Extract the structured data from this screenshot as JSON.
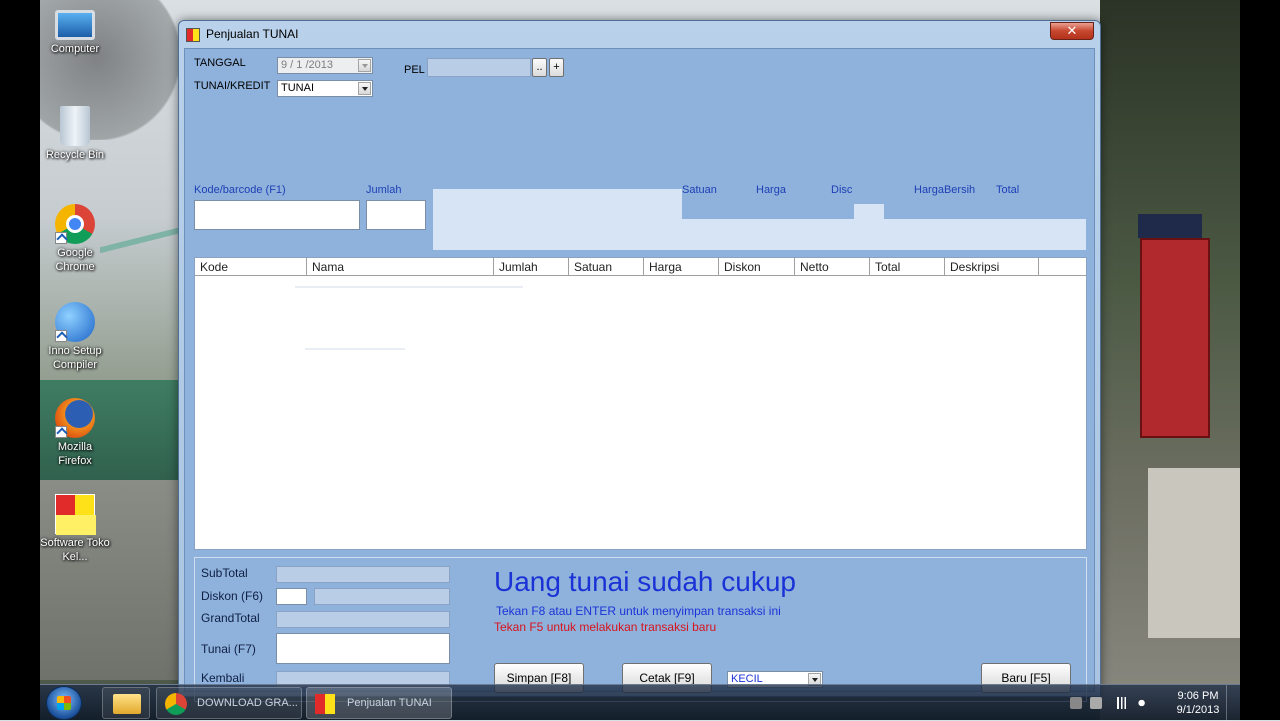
{
  "desktop": {
    "icons": [
      {
        "label": "Computer",
        "icon": "computer-icon"
      },
      {
        "label": "Recycle Bin",
        "icon": "recycle-bin-icon"
      },
      {
        "label": "Google Chrome",
        "icon": "chrome-icon"
      },
      {
        "label": "Inno Setup Compiler",
        "icon": "inno-setup-icon"
      },
      {
        "label": "Mozilla Firefox",
        "icon": "firefox-icon"
      },
      {
        "label": "Software Toko Kel...",
        "icon": "software-toko-icon"
      }
    ]
  },
  "window": {
    "title": "Penjualan TUNAI",
    "close_symbol": "✕"
  },
  "form": {
    "tanggal_label": "TANGGAL",
    "tanggal_value": "9 / 1 /2013",
    "tunai_kredit_label": "TUNAI/KREDIT",
    "tunai_kredit_value": "TUNAI",
    "pel_label": "PEL",
    "pel_browse_label": "..",
    "pel_add_label": "+"
  },
  "entry_headers": {
    "kode": "Kode/barcode (F1)",
    "jumlah": "Jumlah",
    "satuan": "Satuan",
    "harga": "Harga",
    "disc": "Disc",
    "harga_bersih": "HargaBersih",
    "total": "Total"
  },
  "grid": {
    "columns": [
      "Kode",
      "Nama",
      "Jumlah",
      "Satuan",
      "Harga",
      "Diskon",
      "Netto",
      "Total",
      "Deskripsi"
    ]
  },
  "summary": {
    "subtotal_label": "SubTotal",
    "diskon_label": "Diskon (F6)",
    "grandtotal_label": "GrandTotal",
    "tunai_label": "Tunai (F7)",
    "kembali_label": "Kembali"
  },
  "messages": {
    "status": "Uang tunai sudah cukup",
    "hint_save": "Tekan F8 atau ENTER untuk menyimpan transaksi ini",
    "hint_new": "Tekan F5 untuk melakukan transaksi baru"
  },
  "buttons": {
    "simpan": "Simpan [F8]",
    "cetak": "Cetak [F9]",
    "print_size": "KECIL",
    "baru": "Baru [F5]"
  },
  "taskbar": {
    "items": [
      {
        "label": "",
        "icon": "explorer-icon"
      },
      {
        "label": "DOWNLOAD GRA...",
        "icon": "chrome-icon"
      },
      {
        "label": "Penjualan TUNAI",
        "icon": "app-icon"
      }
    ],
    "time": "9:06 PM",
    "date": "9/1/2013"
  }
}
